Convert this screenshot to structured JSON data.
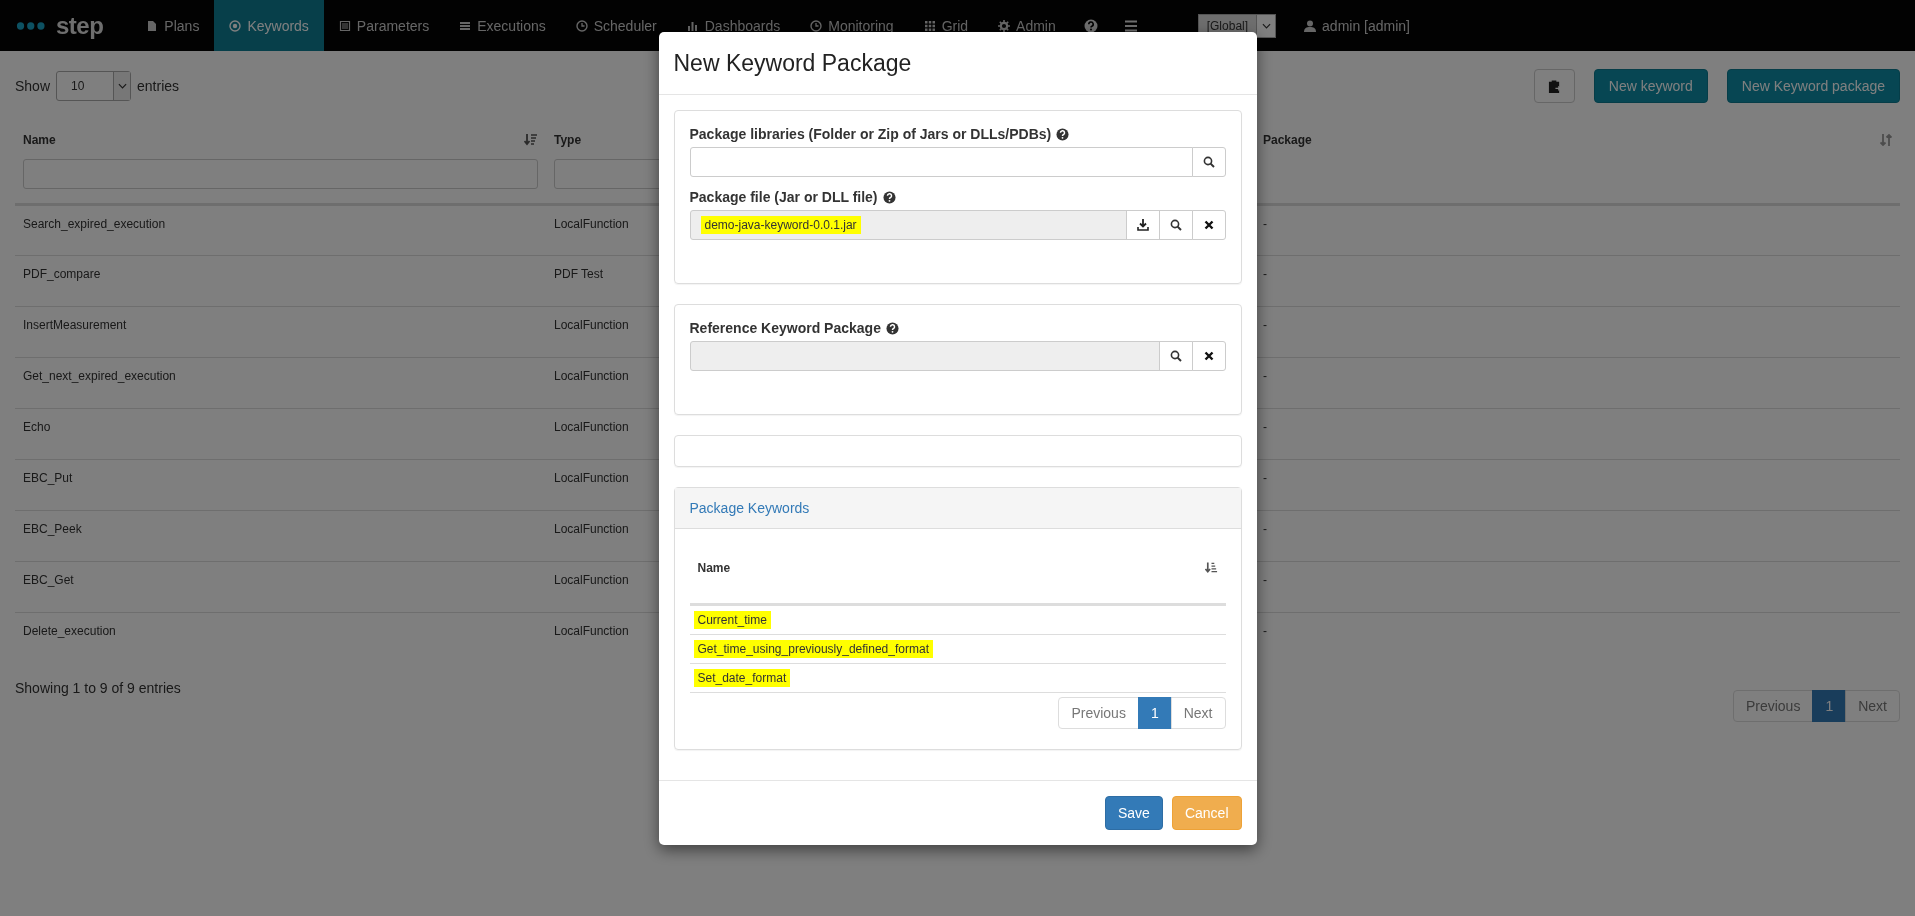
{
  "navbar": {
    "brand": "step",
    "items": [
      {
        "label": "Plans",
        "selected": false
      },
      {
        "label": "Keywords",
        "selected": true
      },
      {
        "label": "Parameters",
        "selected": false
      },
      {
        "label": "Executions",
        "selected": false
      },
      {
        "label": "Scheduler",
        "selected": false
      },
      {
        "label": "Dashboards",
        "selected": false
      },
      {
        "label": "Monitoring",
        "selected": false
      },
      {
        "label": "Grid",
        "selected": false
      },
      {
        "label": "Admin",
        "selected": false
      }
    ],
    "scope_select": "[Global]",
    "user": "admin [admin]"
  },
  "page": {
    "length_before": "Show",
    "length_value": "10",
    "length_after": "entries",
    "actions": [
      {
        "label": "New keyword"
      },
      {
        "label": "New Keyword package"
      }
    ],
    "table": {
      "columns": [
        "Name",
        "Type",
        "Package"
      ],
      "rows": [
        {
          "name": "Search_expired_execution",
          "type": "LocalFunction",
          "package": "-"
        },
        {
          "name": "PDF_compare",
          "type": "PDF Test",
          "package": "-"
        },
        {
          "name": "InsertMeasurement",
          "type": "LocalFunction",
          "package": "-"
        },
        {
          "name": "Get_next_expired_execution",
          "type": "LocalFunction",
          "package": "-"
        },
        {
          "name": "Echo",
          "type": "LocalFunction",
          "package": "-"
        },
        {
          "name": "EBC_Put",
          "type": "LocalFunction",
          "package": "-"
        },
        {
          "name": "EBC_Peek",
          "type": "LocalFunction",
          "package": "-"
        },
        {
          "name": "EBC_Get",
          "type": "LocalFunction",
          "package": "-"
        },
        {
          "name": "Delete_execution",
          "type": "LocalFunction",
          "package": "-"
        }
      ]
    },
    "info": "Showing 1 to 9 of 9 entries",
    "pagination": [
      {
        "label": "Previous",
        "selected": false
      },
      {
        "label": "1",
        "selected": true
      },
      {
        "label": "Next",
        "selected": false
      }
    ]
  },
  "modal": {
    "title": "New Keyword Package",
    "form_panels": [
      {
        "kind": "fields",
        "fields": [
          {
            "kind": "libraries",
            "label": "Package libraries (Folder or Zip of Jars or DLLs/PDBs)",
            "readonly": false
          },
          {
            "kind": "file",
            "label": "Package file (Jar or DLL file)",
            "value": "demo-java-keyword-0.0.1.jar",
            "readonly": true,
            "highlighted": true
          }
        ]
      },
      {
        "kind": "fields",
        "fields": [
          {
            "kind": "reference",
            "label": "Reference Keyword Package",
            "readonly": true
          }
        ]
      },
      {
        "kind": "blank"
      }
    ],
    "keywords_panel": {
      "title": "Package Keywords",
      "column": "Name",
      "rows": [
        {
          "name": "Current_time",
          "highlighted": true
        },
        {
          "name": "Get_time_using_previously_defined_format",
          "highlighted": true
        },
        {
          "name": "Set_date_format",
          "highlighted": true
        }
      ],
      "pagination": [
        {
          "label": "Previous",
          "selected": false
        },
        {
          "label": "1",
          "selected": true
        },
        {
          "label": "Next",
          "selected": false
        }
      ]
    },
    "buttons": [
      {
        "label": "Save",
        "kind": "primary"
      },
      {
        "label": "Cancel",
        "kind": "warning"
      }
    ]
  }
}
